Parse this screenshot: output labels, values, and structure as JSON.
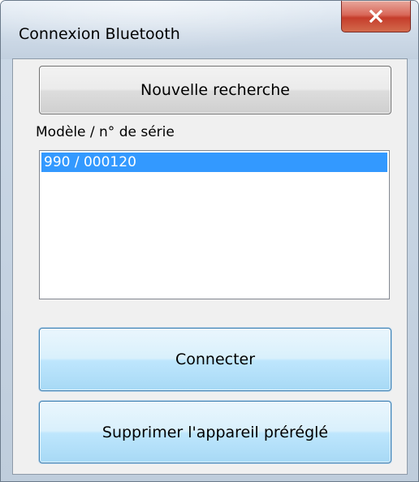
{
  "window": {
    "title": "Connexion Bluetooth",
    "close_icon": "close-x-icon",
    "colors": {
      "close_button": "#c94b3a",
      "selection": "#3399ff",
      "client_background": "#f0f0f0"
    }
  },
  "buttons": {
    "new_search_label": "Nouvelle recherche",
    "connect_label": "Connecter",
    "delete_preset_label": "Supprimer l'appareil préréglé"
  },
  "device_list": {
    "label": "Modèle / n° de série",
    "items": [
      {
        "label": "990 / 000120",
        "selected": true
      }
    ]
  }
}
